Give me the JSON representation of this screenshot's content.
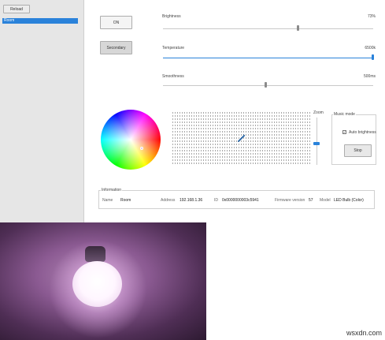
{
  "sidebar": {
    "reload_label": "Reload",
    "devices": [
      "Room"
    ]
  },
  "controls": {
    "on_label": "ON",
    "secondary_label": "Secondary",
    "brightness": {
      "label": "Brightness",
      "value_text": "73%",
      "value": 0.73
    },
    "temperature": {
      "label": "Temperature",
      "value_text": "6500k",
      "value": 1.0
    },
    "smoothness": {
      "label": "Smoothness",
      "value_text": "500ms",
      "value": 0.5
    }
  },
  "color_picker": {
    "zoom_label": "Zoom",
    "music_mode_title": "Music mode",
    "auto_brightness_label": "Auto brightness",
    "auto_brightness_checked": true,
    "stop_label": "Stop"
  },
  "information": {
    "title": "Information",
    "fields": [
      {
        "key": "Name",
        "value": "Room"
      },
      {
        "key": "Address",
        "value": "192.168.1.36"
      },
      {
        "key": "ID",
        "value": "0x0000000003c5941"
      },
      {
        "key": "Firmware version",
        "value": "57"
      },
      {
        "key": "Model",
        "value": "LED Bulb (Color)"
      }
    ]
  },
  "colors": {
    "accent": "#2a82da"
  },
  "watermark": "wsxdn.com"
}
